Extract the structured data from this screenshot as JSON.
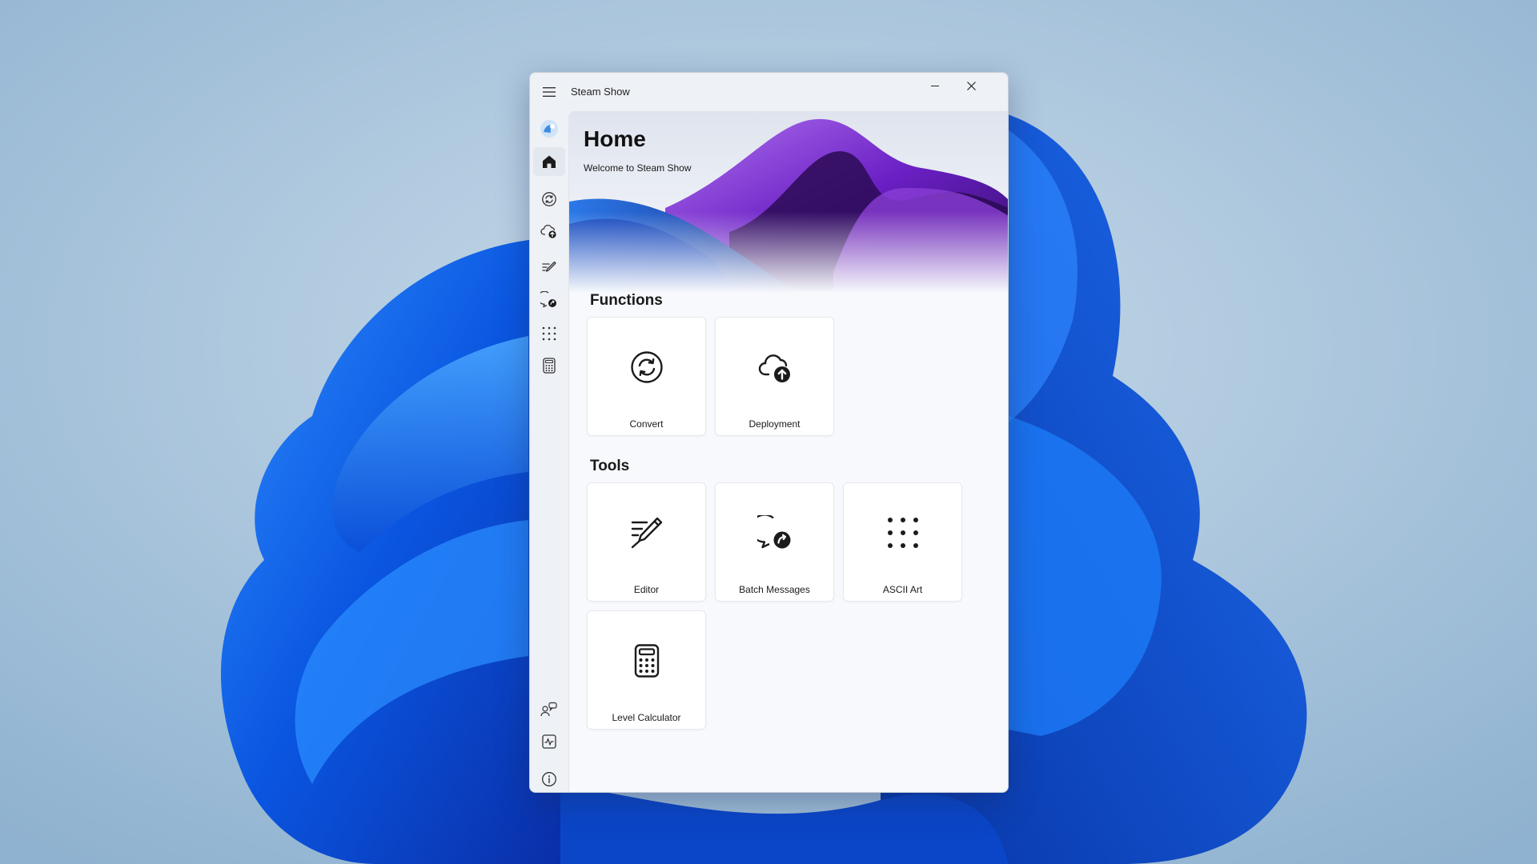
{
  "window": {
    "title": "Steam Show"
  },
  "nav": {
    "items": [
      {
        "name": "home",
        "icon": "home-icon",
        "selected": true
      },
      {
        "name": "convert",
        "icon": "sync-icon"
      },
      {
        "name": "deployment",
        "icon": "cloud-upload-icon"
      },
      {
        "name": "editor",
        "icon": "edit-icon"
      },
      {
        "name": "batch-messages",
        "icon": "chat-reply-icon"
      },
      {
        "name": "ascii-art",
        "icon": "dot-grid-icon"
      },
      {
        "name": "level-calculator",
        "icon": "calculator-icon"
      }
    ],
    "footer": [
      {
        "name": "accounts",
        "icon": "people-chat-icon"
      },
      {
        "name": "monitor",
        "icon": "pulse-icon"
      },
      {
        "name": "about",
        "icon": "info-icon"
      }
    ]
  },
  "hero": {
    "title": "Home",
    "subtitle": "Welcome to Steam Show"
  },
  "functions": {
    "title": "Functions",
    "tiles": [
      {
        "label": "Convert",
        "icon": "sync-icon"
      },
      {
        "label": "Deployment",
        "icon": "cloud-upload-icon"
      }
    ]
  },
  "tools": {
    "title": "Tools",
    "tiles": [
      {
        "label": "Editor",
        "icon": "edit-icon"
      },
      {
        "label": "Batch Messages",
        "icon": "chat-reply-icon"
      },
      {
        "label": "ASCII Art",
        "icon": "dot-grid-icon"
      },
      {
        "label": "Level Calculator",
        "icon": "calculator-icon"
      }
    ]
  },
  "colors": {
    "accent": "#0067c0",
    "wallpaper": "#9cbad6",
    "bloom": "#1a5ce0"
  }
}
